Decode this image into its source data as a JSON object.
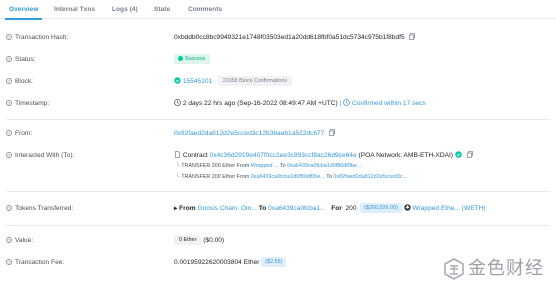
{
  "tabs": [
    {
      "label": "Overview"
    },
    {
      "label": "Internal Txns"
    },
    {
      "label": "Logs (4)"
    },
    {
      "label": "State"
    },
    {
      "label": "Comments"
    }
  ],
  "fields": {
    "tx_hash": {
      "label": "Transaction Hash:",
      "value": "0xbddb0cc8bc9949321e1748f03503ed1a20dd618fbf0a51dc5734c975b1f8bdf5"
    },
    "status": {
      "label": "Status:",
      "value": "Success"
    },
    "block": {
      "label": "Block:",
      "value": "15545101",
      "confirmations": "21058 Block Confirmations"
    },
    "timestamp": {
      "label": "Timestamp:",
      "value": "2 days 22 hrs ago (Sep-16-2022 08:49:47 AM +UTC)",
      "confirmed": "Confirmed within 17 secs"
    },
    "from": {
      "label": "From:",
      "value": "0x82faed2da812d2e5cced3c12b3baeb1a522dc677"
    },
    "interacted": {
      "label": "Interacted With (To):",
      "contract_prefix": "Contract",
      "contract": "0x4c36d2919e407f0cc2ee3c993ccf8ac26d9ce64e",
      "contract_name": "(POA Network: AMB-ETH-XDAI)",
      "transfers": [
        {
          "prefix": "TRANSFER",
          "amount": "200 Ether From",
          "from": "Wrapped ...",
          "to_prefix": "To",
          "to": "0xa6439ca0fcba1d0f80df0be..."
        },
        {
          "prefix": "TRANSFER",
          "amount": "200 Ether From",
          "from": "0xa6439ca0fcba1d0f80df0be...",
          "to_prefix": "To",
          "to": "0x82faed2da812d2e5cced3c..."
        }
      ]
    },
    "tokens": {
      "label": "Tokens Transferred:",
      "from_prefix": "From",
      "from": "Gnosis Chain: Om...",
      "to_prefix": "To",
      "to": "0xa6439ca0fcba1...",
      "for_prefix": "For",
      "amount": "200",
      "usd": "($260,026.00)",
      "token": "Wrapped Ethe... (WETH)"
    },
    "value": {
      "label": "Value:",
      "value": "0 Ether",
      "usd": "($0.00)"
    },
    "fee": {
      "label": "Transaction Fee:",
      "value": "0.00195922620003804 Ether",
      "usd": "($2.55)"
    }
  },
  "watermark": {
    "text": "金色财经"
  },
  "colors": {
    "accent": "#3498db",
    "success": "#00c9a7",
    "text": "#1e2022",
    "muted": "#77838f",
    "border": "#e7eaf3"
  }
}
